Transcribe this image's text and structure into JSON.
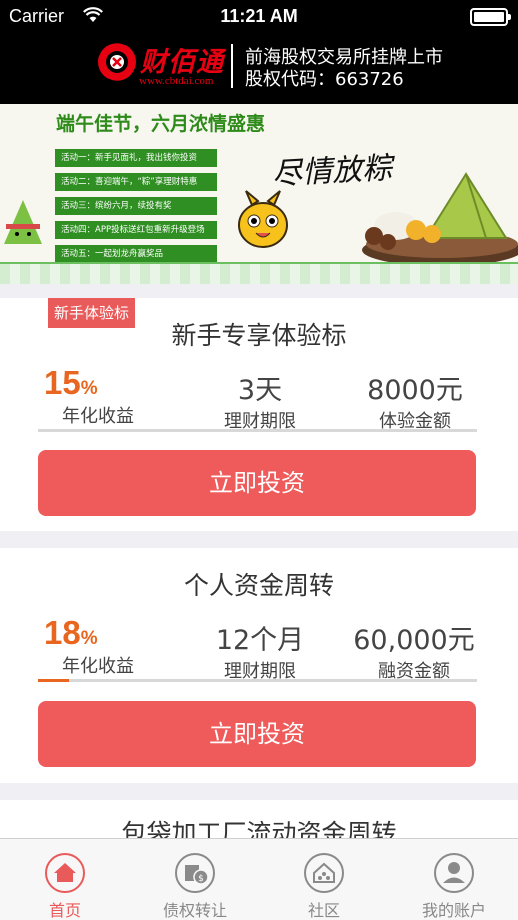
{
  "status_bar": {
    "carrier": "Carrier",
    "time": "11:21 AM"
  },
  "header": {
    "logo_text": "财佰通",
    "logo_url": "www.cbtdai.com",
    "line1": "前海股权交易所挂牌上市",
    "line2": "股权代码：663726"
  },
  "banner": {
    "title": "端午佳节，六月浓情盛惠",
    "items": [
      "活动一：新手见面礼，我出钱你投资",
      "活动二：喜迎端午，“粽”享理财特惠",
      "活动三：缤纷六月，续投有奖",
      "活动四：APP投标送红包重新升级登场",
      "活动五：一起划龙舟赢奖品"
    ],
    "script_text": "尽情放粽"
  },
  "cards": [
    {
      "tag": "新手体验标",
      "title": "新手专享体验标",
      "rate": "15",
      "rate_unit": "%",
      "rate_label": "年化收益",
      "term": "3天",
      "term_label": "理财期限",
      "amount": "8000元",
      "amount_label": "体验金额",
      "progress_fraction": 0,
      "button": "立即投资"
    },
    {
      "title": "个人资金周转",
      "rate": "18",
      "rate_unit": "%",
      "rate_label": "年化收益",
      "term": "12个月",
      "term_label": "理财期限",
      "amount": "60,000元",
      "amount_label": "融资金额",
      "progress_fraction": 0.07,
      "button": "立即投资"
    },
    {
      "title": "包袋加工厂流动资金周转"
    }
  ],
  "tabbar": {
    "tabs": [
      {
        "label": "首页",
        "icon": "home-icon",
        "active": true
      },
      {
        "label": "债权转让",
        "icon": "transfer-icon",
        "active": false
      },
      {
        "label": "社区",
        "icon": "community-icon",
        "active": false
      },
      {
        "label": "我的账户",
        "icon": "account-icon",
        "active": false
      }
    ]
  },
  "colors": {
    "accent": "#ef5a5a",
    "rate": "#e8661f",
    "brand": "#e60012"
  }
}
